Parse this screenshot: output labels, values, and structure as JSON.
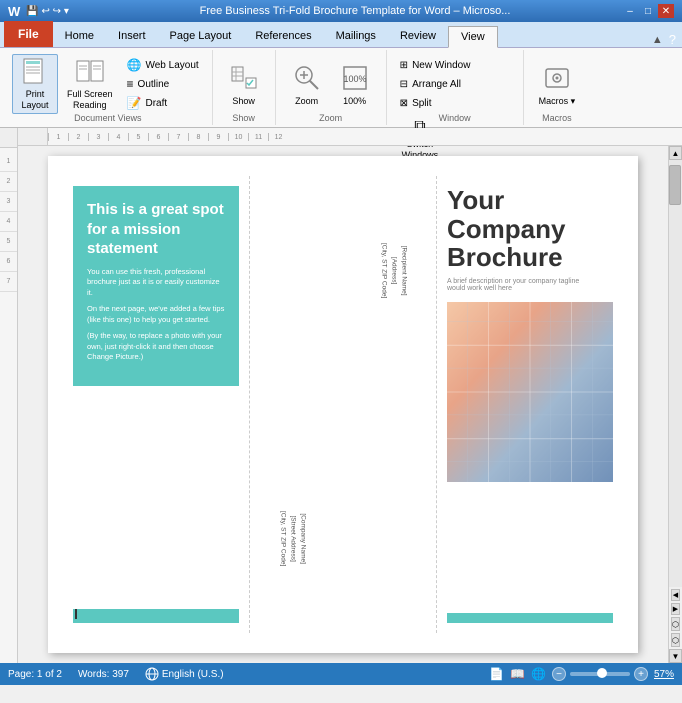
{
  "titleBar": {
    "title": "Free Business Tri-Fold Brochure Template for Word – Microsо...",
    "minBtn": "–",
    "maxBtn": "□",
    "closeBtn": "✕"
  },
  "tabs": [
    {
      "id": "file",
      "label": "File",
      "active": false
    },
    {
      "id": "home",
      "label": "Home",
      "active": false
    },
    {
      "id": "insert",
      "label": "Insert",
      "active": false
    },
    {
      "id": "pagelayout",
      "label": "Page Layout",
      "active": false
    },
    {
      "id": "references",
      "label": "References",
      "active": false
    },
    {
      "id": "mailings",
      "label": "Mailings",
      "active": false
    },
    {
      "id": "review",
      "label": "Review",
      "active": false
    },
    {
      "id": "view",
      "label": "View",
      "active": true
    }
  ],
  "ribbon": {
    "groups": [
      {
        "id": "document-views",
        "label": "Document Views",
        "buttons": [
          {
            "id": "print-layout",
            "label": "Print\nLayout",
            "icon": "📄",
            "active": true
          },
          {
            "id": "full-screen-reading",
            "label": "Full Screen\nReading",
            "icon": "📖",
            "active": false
          }
        ],
        "smallButtons": [
          {
            "id": "web-layout",
            "label": "Web Layout",
            "icon": "🌐"
          },
          {
            "id": "outline",
            "label": "Outline",
            "icon": "≡"
          },
          {
            "id": "draft",
            "label": "Draft",
            "icon": "📝"
          }
        ]
      },
      {
        "id": "show",
        "label": "Show",
        "buttons": [
          {
            "id": "show-btn",
            "label": "Show",
            "icon": "☑",
            "active": false
          }
        ],
        "smallButtons": []
      },
      {
        "id": "zoom",
        "label": "Zoom",
        "buttons": [
          {
            "id": "zoom-btn",
            "label": "Zoom",
            "icon": "🔍",
            "active": false
          },
          {
            "id": "zoom-100",
            "label": "100%",
            "icon": "□",
            "active": false
          }
        ],
        "smallButtons": []
      },
      {
        "id": "window",
        "label": "Window",
        "buttons": [
          {
            "id": "new-window",
            "label": "New Window",
            "icon": "⊞"
          },
          {
            "id": "arrange-all",
            "label": "Arrange All",
            "icon": "⊟"
          },
          {
            "id": "split",
            "label": "Split",
            "icon": "⊠"
          },
          {
            "id": "switch-windows",
            "label": "Switch\nWindows",
            "icon": "⧉"
          }
        ],
        "smallButtons": []
      },
      {
        "id": "macros",
        "label": "Macros",
        "buttons": [
          {
            "id": "macros-btn",
            "label": "Macros",
            "icon": "⏺"
          }
        ],
        "smallButtons": []
      }
    ]
  },
  "document": {
    "leftPanel": {
      "heading": "This is a great spot for a mission statement",
      "body1": "You can use this fresh, professional brochure just as it is or easily customize it.",
      "body2": "On the next page, we've added a few tips (like this one) to help you get started.",
      "body3": "(By the way, to replace a photo with your own, just right-click it and then choose Change Picture.)"
    },
    "middlePanel": {
      "addressTop1": "[Recipient Name]",
      "addressTop2": "[Address]",
      "addressTop3": "[City, ST  ZIP Code]",
      "addressBottom1": "[Company Name]",
      "addressBottom2": "[Street Address]",
      "addressBottom3": "[City, ST  ZIP Code]"
    },
    "rightPanel": {
      "companyName": "Your\nCompany\nBrochure",
      "tagline": "A brief description or your company tagline\nwould work well here"
    }
  },
  "statusBar": {
    "page": "Page: 1 of 2",
    "words": "Words: 397",
    "language": "English (U.S.)",
    "zoom": "57%"
  }
}
